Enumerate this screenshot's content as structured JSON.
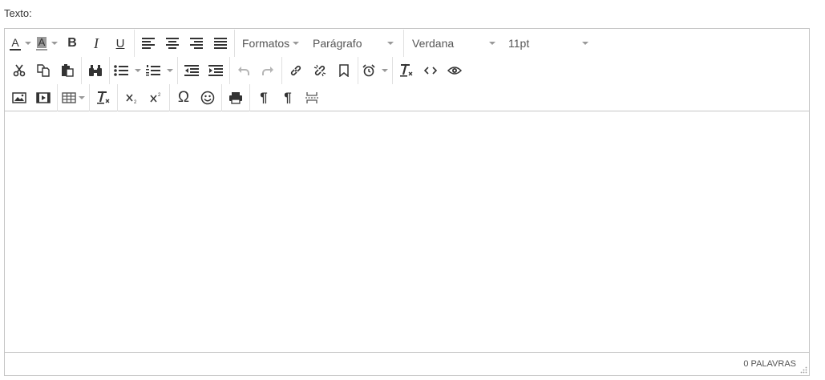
{
  "field": {
    "label": "Texto:"
  },
  "toolbar": {
    "formats_label": "Formatos",
    "block_label": "Parágrafo",
    "font_family": "Verdana",
    "font_size": "11pt",
    "text_color_glyph": "A",
    "bg_color_glyph": "A",
    "bold_glyph": "B",
    "italic_glyph": "I",
    "underline_glyph": "U",
    "omega_glyph": "Ω",
    "pilcrow_glyph": "¶"
  },
  "statusbar": {
    "wordcount": "0 PALAVRAS"
  },
  "icons": [
    "text-color-icon",
    "background-color-icon",
    "bold-icon",
    "italic-icon",
    "underline-icon",
    "align-left-icon",
    "align-center-icon",
    "align-right-icon",
    "align-justify-icon",
    "cut-icon",
    "copy-icon",
    "paste-icon",
    "find-replace-icon",
    "bullet-list-icon",
    "numbered-list-icon",
    "outdent-icon",
    "indent-icon",
    "undo-icon",
    "redo-icon",
    "link-icon",
    "unlink-icon",
    "bookmark-icon",
    "alarm-clock-icon",
    "remove-format-icon",
    "code-icon",
    "preview-eye-icon",
    "image-icon",
    "media-icon",
    "table-icon",
    "clear-format-icon",
    "subscript-icon",
    "superscript-icon",
    "omega-icon",
    "emoticon-icon",
    "print-icon",
    "ltr-icon",
    "rtl-icon",
    "page-break-icon"
  ]
}
